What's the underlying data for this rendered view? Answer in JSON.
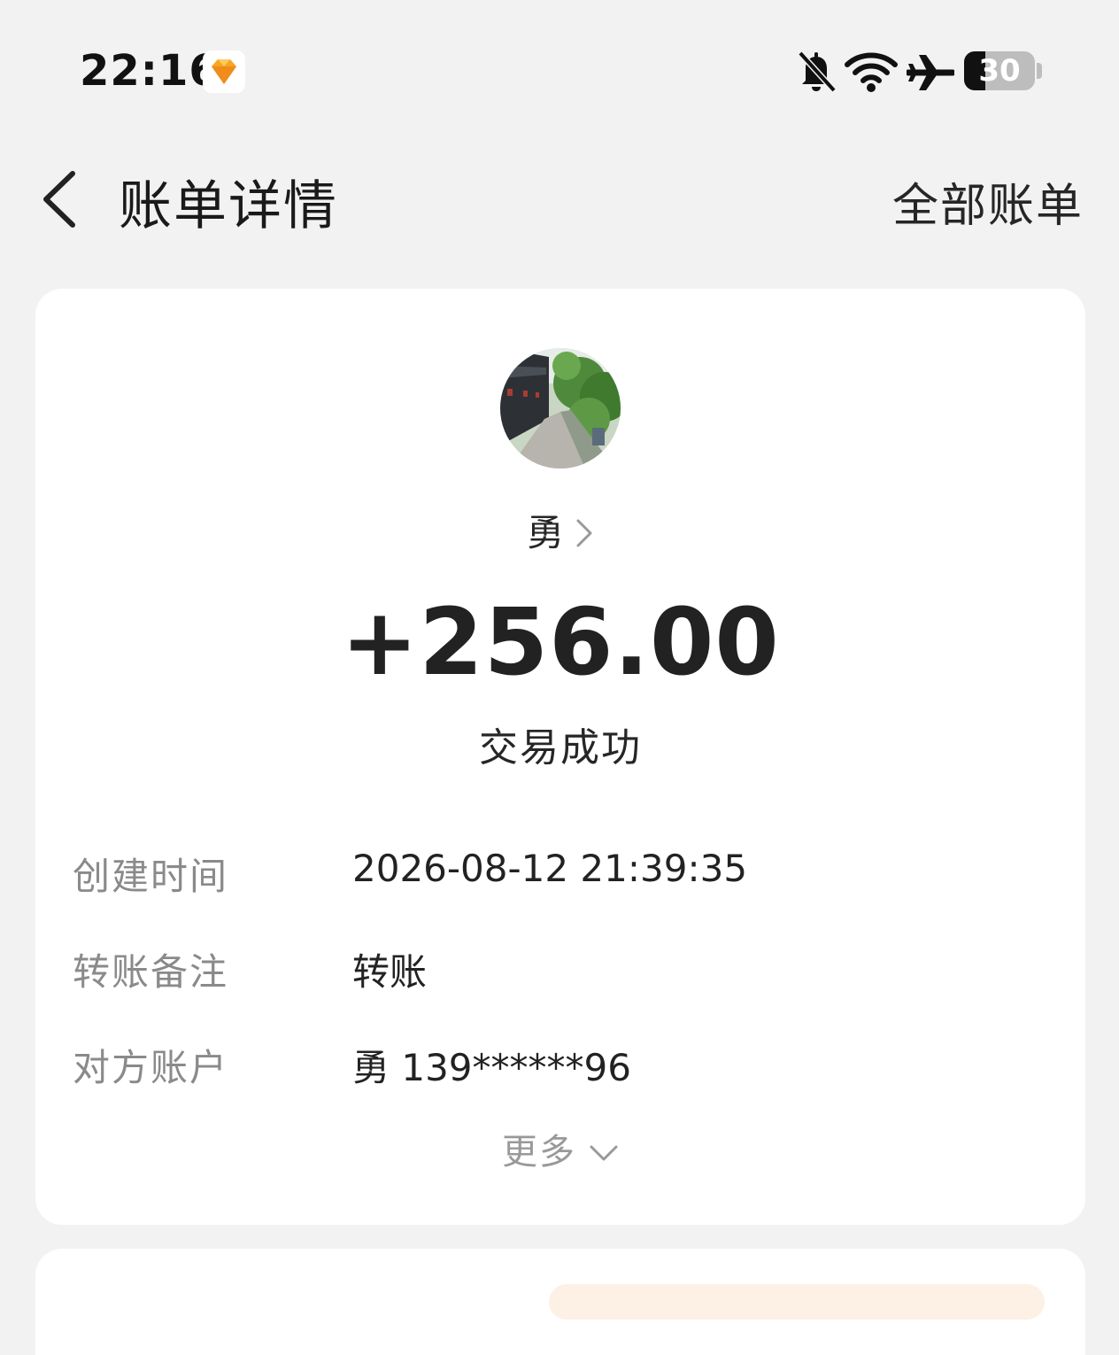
{
  "status_bar": {
    "time": "22:16",
    "battery_level": "30",
    "battery_fraction": 0.3,
    "icons": [
      "app-notification-icon",
      "mute-icon",
      "wifi-icon",
      "airplane-mode-icon",
      "battery-icon"
    ]
  },
  "nav": {
    "title": "账单详情",
    "all_bills": "全部账单"
  },
  "bill": {
    "counterparty_name": "勇",
    "amount": "+256.00",
    "status": "交易成功",
    "details": [
      {
        "label": "创建时间",
        "value": "2026-08-12 21:39:35"
      },
      {
        "label": "转账备注",
        "value": "转账"
      },
      {
        "label": "对方账户",
        "value": "勇 139******96"
      }
    ],
    "more": "更多"
  },
  "colors": {
    "background": "#f2f2f2",
    "card": "#ffffff",
    "label": "#8a8a8a",
    "text": "#222222",
    "notif_icon": "#f5a623"
  }
}
